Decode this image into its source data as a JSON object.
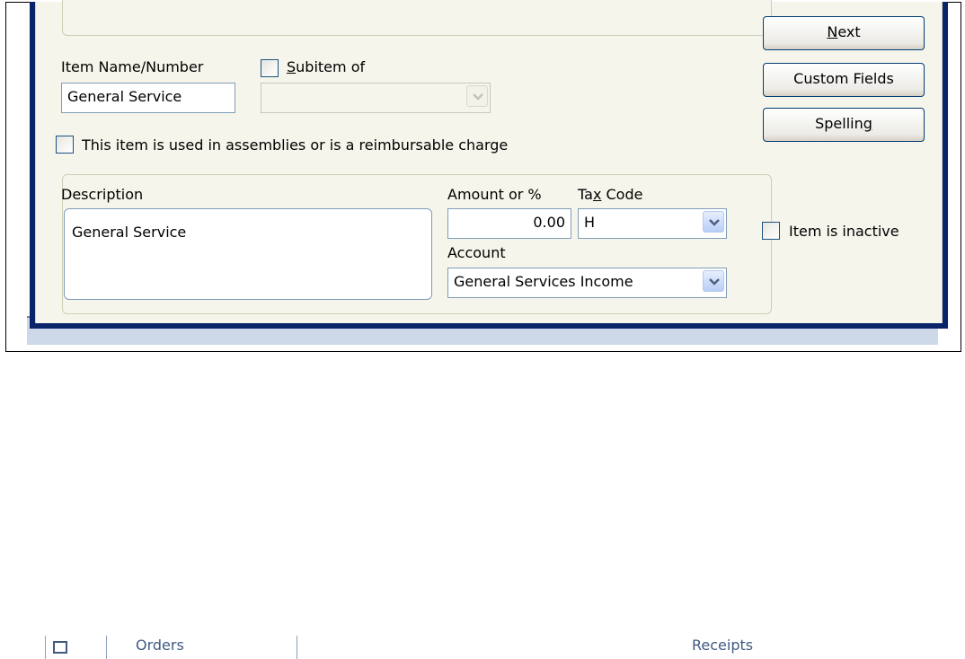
{
  "background": {
    "tab_orders": "Orders",
    "tab_receipts": "Receipts"
  },
  "form": {
    "item_name_label": "Item Name/Number",
    "item_name_value": "General Service",
    "subitem_label_accel": "S",
    "subitem_label_rest": "ubitem of",
    "subitem_value": "",
    "subitem_checked": false,
    "assembly_label": "This item is used in assemblies or is a reimbursable charge",
    "assembly_checked": false,
    "description_label": "Description",
    "description_value": "General Service",
    "amount_label": "Amount or %",
    "amount_value": "0.00",
    "tax_code_label_pre": "Ta",
    "tax_code_label_accel": "x",
    "tax_code_label_post": " Code",
    "tax_code_value": "H",
    "account_label": "Account",
    "account_value": "General Services Income"
  },
  "buttons": {
    "next_accel": "N",
    "next_rest": "ext",
    "custom_fields": "Custom Fields",
    "spelling_pre": "Spellin",
    "spelling_accel": "g"
  },
  "inactive": {
    "label": "Item is inactive",
    "checked": false
  },
  "colors": {
    "dialog_frame": "#0a246a",
    "dialog_face": "#f6f5ec",
    "button_border": "#003c74",
    "input_border": "#7f9db9"
  }
}
